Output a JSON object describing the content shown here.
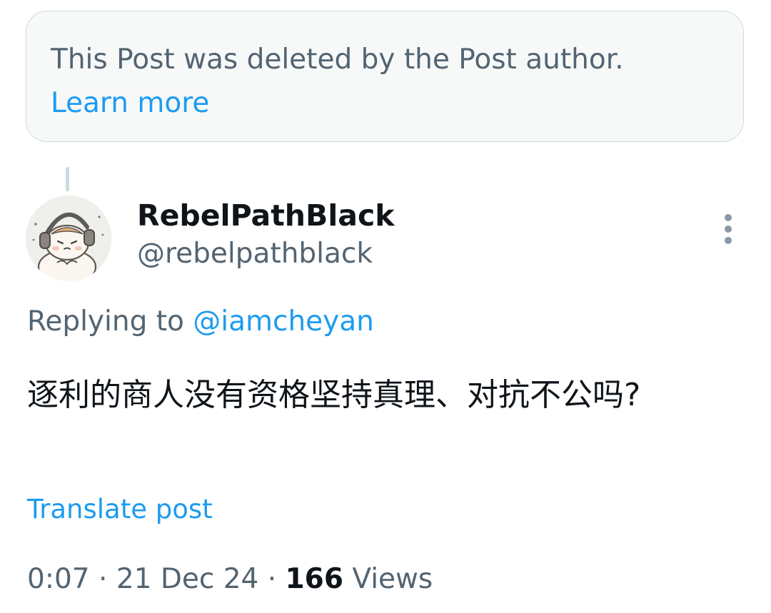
{
  "deleted_notice": {
    "text": "This Post was deleted by the Post author.",
    "link_label": "Learn more"
  },
  "post": {
    "author": {
      "display_name": "RebelPathBlack",
      "handle": "@rebelpathblack",
      "avatar_icon": "cartoon-hamster-headphones-avatar"
    },
    "replying_prefix": "Replying to",
    "replying_to": "@iamcheyan",
    "text": "逐利的商人没有资格坚持真理、对抗不公吗?",
    "translate_label": "Translate post",
    "time": "0:07",
    "separator": "·",
    "date": "21 Dec 24",
    "views_count": "166",
    "views_label": "Views"
  },
  "colors": {
    "accent": "#1d9bf0",
    "secondary_text": "#536471",
    "primary_text": "#0f1419",
    "notice_bg": "#f7f9f9",
    "border": "#cfd9de"
  },
  "icons": {
    "more": "more-vertical-icon"
  }
}
